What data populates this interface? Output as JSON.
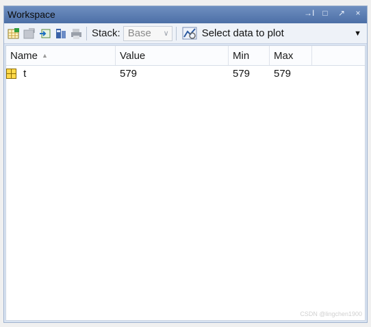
{
  "window": {
    "title": "Workspace",
    "controls": [
      "→I",
      "□",
      "↗",
      "×"
    ]
  },
  "toolbar": {
    "stack_label": "Stack:",
    "stack_value": "Base",
    "plot_label": "Select data to plot",
    "icons": [
      "new-variable-icon",
      "open-variable-icon",
      "load-data-icon",
      "save-workspace-icon",
      "print-icon"
    ]
  },
  "table": {
    "headers": {
      "name": "Name",
      "value": "Value",
      "min": "Min",
      "max": "Max"
    },
    "rows": [
      {
        "name": "t",
        "value": "579",
        "min": "579",
        "max": "579"
      }
    ]
  },
  "watermark": "CSDN @lingchen1900"
}
